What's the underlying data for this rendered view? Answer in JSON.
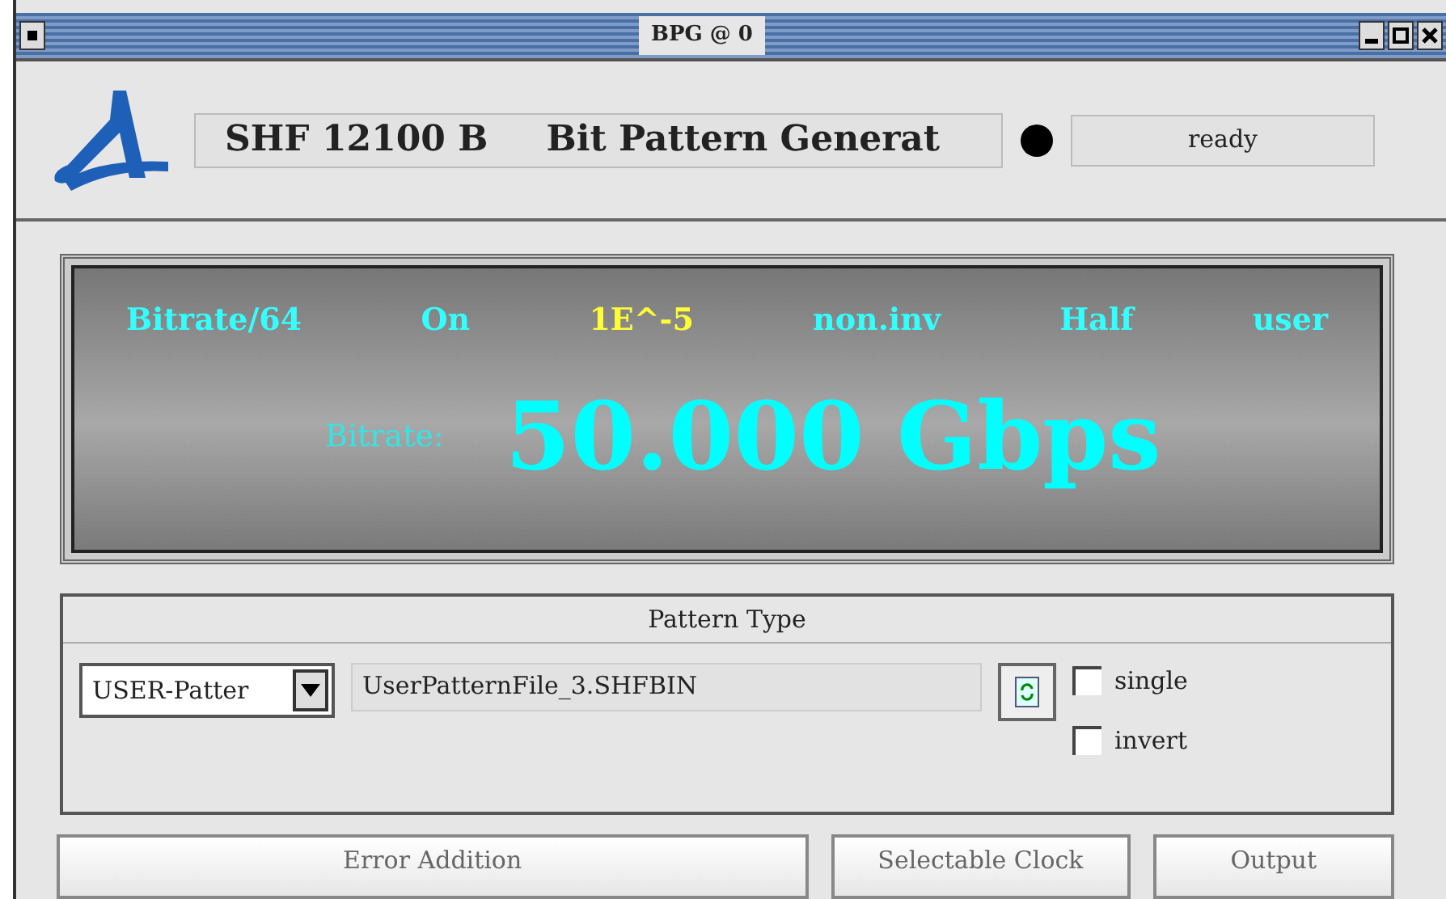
{
  "window": {
    "title": "BPG @ 0"
  },
  "header": {
    "model": "SHF 12100 B",
    "product": "Bit Pattern Generat",
    "status": "ready"
  },
  "display": {
    "indicators": [
      {
        "text": "Bitrate/64",
        "color": "#33ffff"
      },
      {
        "text": "On",
        "color": "#33ffff"
      },
      {
        "text": "1E^-5",
        "color": "#ffff33"
      },
      {
        "text": "non.inv",
        "color": "#33ffff"
      },
      {
        "text": "Half",
        "color": "#33ffff"
      },
      {
        "text": "user",
        "color": "#33ffff"
      }
    ],
    "label": "Bitrate:",
    "value": "50.000 Gbps"
  },
  "pattern_type": {
    "title": "Pattern Type",
    "selection": "USER-Patter",
    "file": "UserPatternFile_3.SHFBIN",
    "options": [
      {
        "label": "single",
        "checked": false
      },
      {
        "label": "invert",
        "checked": false
      }
    ]
  },
  "sections": [
    {
      "title": "Error Addition"
    },
    {
      "title": "Selectable Clock"
    },
    {
      "title": "Output"
    }
  ]
}
